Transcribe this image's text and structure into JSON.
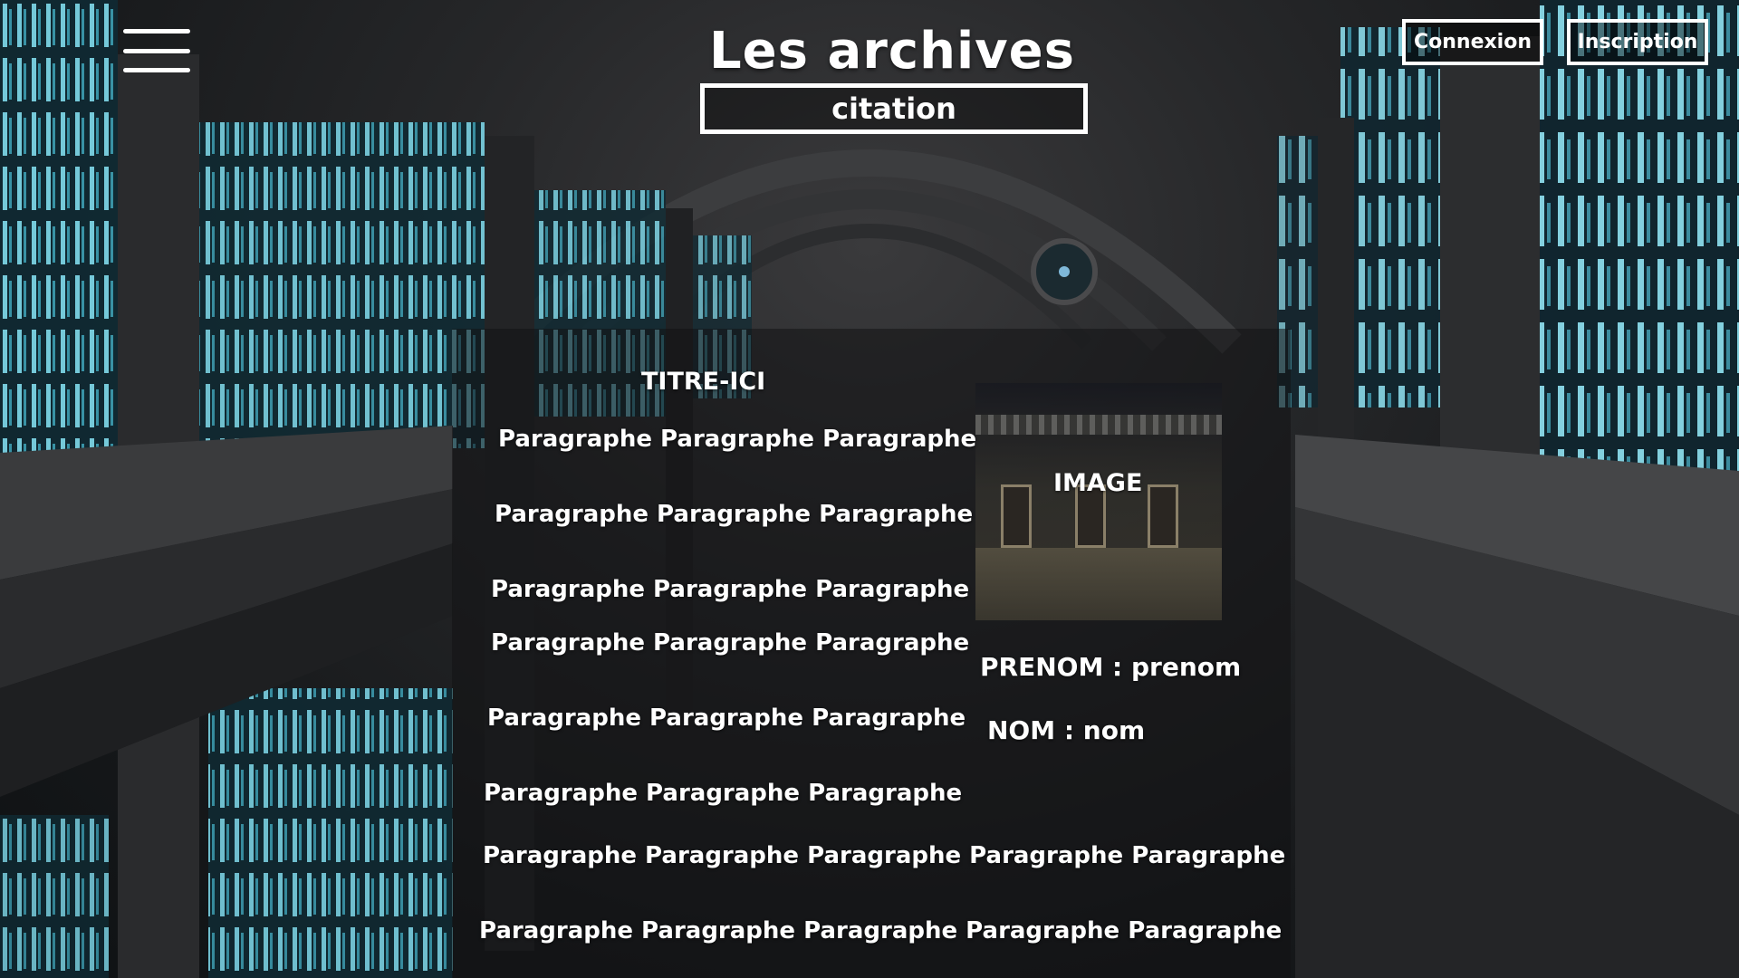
{
  "header": {
    "menu_icon": "hamburger-menu-icon",
    "title": "Les archives",
    "quote": "citation",
    "login_label": "Connexion",
    "signup_label": "Inscription"
  },
  "article": {
    "title": "TITRE-ICI",
    "paragraphs": [
      "Paragraphe Paragraphe Paragraphe",
      "Paragraphe Paragraphe Paragraphe",
      "Paragraphe Paragraphe Paragraphe",
      "Paragraphe Paragraphe Paragraphe",
      "Paragraphe Paragraphe Paragraphe",
      "Paragraphe Paragraphe Paragraphe",
      "Paragraphe Paragraphe Paragraphe Paragraphe Paragraphe",
      "Paragraphe Paragraphe Paragraphe Paragraphe Paragraphe"
    ]
  },
  "profile": {
    "image_label": "IMAGE",
    "prenom": "PRENOM : prenom",
    "nom": "NOM : nom"
  },
  "colors": {
    "text": "#ffffff",
    "panel": "#121314",
    "accent_glow": "#6fd3e6"
  }
}
